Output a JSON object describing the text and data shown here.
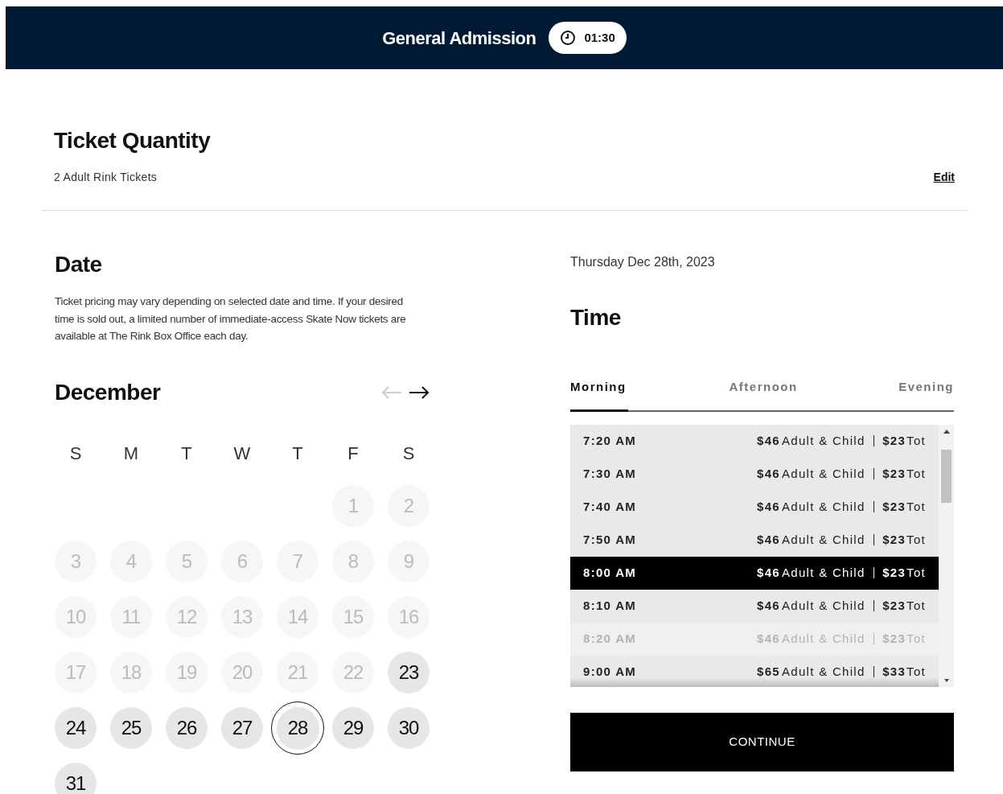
{
  "header": {
    "title": "General Admission",
    "timer": "01:30"
  },
  "ticket_quantity": {
    "title": "Ticket Quantity",
    "summary": "2 Adult Rink Tickets",
    "edit_link": "Edit"
  },
  "date": {
    "title": "Date",
    "note": "Ticket pricing may vary depending on selected date and time. If your desired time is sold out, a limited number of immediate-access Skate Now tickets are available at The Rink Box Office each day.",
    "month": "December",
    "prev_disabled": true,
    "next_disabled": false,
    "weekdays": [
      "S",
      "M",
      "T",
      "W",
      "T",
      "F",
      "S"
    ],
    "days": [
      {
        "day": "1",
        "available": false,
        "selected": false
      },
      {
        "day": "2",
        "available": false,
        "selected": false
      },
      {
        "day": "3",
        "available": false,
        "selected": false
      },
      {
        "day": "4",
        "available": false,
        "selected": false
      },
      {
        "day": "5",
        "available": false,
        "selected": false
      },
      {
        "day": "6",
        "available": false,
        "selected": false
      },
      {
        "day": "7",
        "available": false,
        "selected": false
      },
      {
        "day": "8",
        "available": false,
        "selected": false
      },
      {
        "day": "9",
        "available": false,
        "selected": false
      },
      {
        "day": "10",
        "available": false,
        "selected": false
      },
      {
        "day": "11",
        "available": false,
        "selected": false
      },
      {
        "day": "12",
        "available": false,
        "selected": false
      },
      {
        "day": "13",
        "available": false,
        "selected": false
      },
      {
        "day": "14",
        "available": false,
        "selected": false
      },
      {
        "day": "15",
        "available": false,
        "selected": false
      },
      {
        "day": "16",
        "available": false,
        "selected": false
      },
      {
        "day": "17",
        "available": false,
        "selected": false
      },
      {
        "day": "18",
        "available": false,
        "selected": false
      },
      {
        "day": "19",
        "available": false,
        "selected": false
      },
      {
        "day": "20",
        "available": false,
        "selected": false
      },
      {
        "day": "21",
        "available": false,
        "selected": false
      },
      {
        "day": "22",
        "available": false,
        "selected": false
      },
      {
        "day": "23",
        "available": true,
        "selected": false
      },
      {
        "day": "24",
        "available": true,
        "selected": false
      },
      {
        "day": "25",
        "available": true,
        "selected": false
      },
      {
        "day": "26",
        "available": true,
        "selected": false
      },
      {
        "day": "27",
        "available": true,
        "selected": false
      },
      {
        "day": "28",
        "available": true,
        "selected": true
      },
      {
        "day": "29",
        "available": true,
        "selected": false
      },
      {
        "day": "30",
        "available": true,
        "selected": false
      },
      {
        "day": "31",
        "available": true,
        "selected": false
      }
    ]
  },
  "time": {
    "selected_date": "Thursday Dec 28th, 2023",
    "title": "Time",
    "tabs": [
      {
        "label": "Morning",
        "selected": true
      },
      {
        "label": "Afternoon",
        "selected": false
      },
      {
        "label": "Evening",
        "selected": false
      }
    ],
    "slots": [
      {
        "time": "7:20 AM",
        "price_1": "$46",
        "label_1": "Adult & Child",
        "price_2": "$23",
        "label_2": "Tot",
        "selected": false,
        "disabled": false
      },
      {
        "time": "7:30 AM",
        "price_1": "$46",
        "label_1": "Adult & Child",
        "price_2": "$23",
        "label_2": "Tot",
        "selected": false,
        "disabled": false
      },
      {
        "time": "7:40 AM",
        "price_1": "$46",
        "label_1": "Adult & Child",
        "price_2": "$23",
        "label_2": "Tot",
        "selected": false,
        "disabled": false
      },
      {
        "time": "7:50 AM",
        "price_1": "$46",
        "label_1": "Adult & Child",
        "price_2": "$23",
        "label_2": "Tot",
        "selected": false,
        "disabled": false
      },
      {
        "time": "8:00 AM",
        "price_1": "$46",
        "label_1": "Adult & Child",
        "price_2": "$23",
        "label_2": "Tot",
        "selected": true,
        "disabled": false
      },
      {
        "time": "8:10 AM",
        "price_1": "$46",
        "label_1": "Adult & Child",
        "price_2": "$23",
        "label_2": "Tot",
        "selected": false,
        "disabled": false
      },
      {
        "time": "8:20 AM",
        "price_1": "$46",
        "label_1": "Adult & Child",
        "price_2": "$23",
        "label_2": "Tot",
        "selected": false,
        "disabled": true
      },
      {
        "time": "9:00 AM",
        "price_1": "$65",
        "label_1": "Adult & Child",
        "price_2": "$33",
        "label_2": "Tot",
        "selected": false,
        "disabled": false
      }
    ],
    "continue_button": "CONTINUE"
  }
}
